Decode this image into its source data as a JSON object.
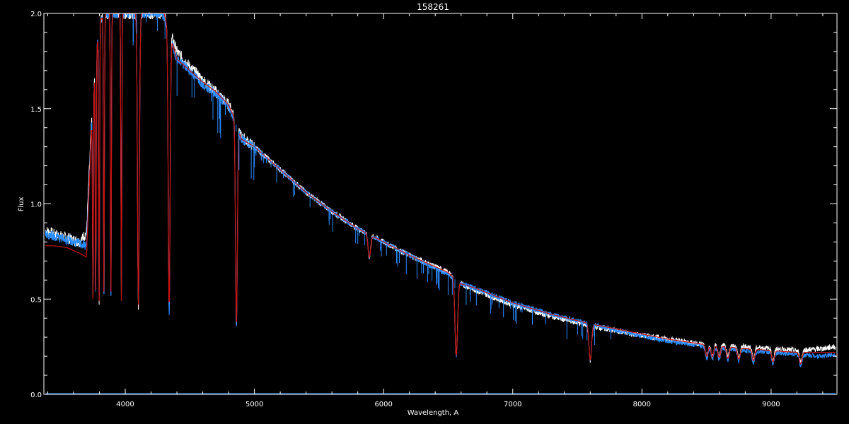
{
  "chart_data": {
    "type": "line",
    "title": "158261",
    "xlabel": "Wavelength, A",
    "ylabel": "Flux",
    "xlim": [
      3370,
      9510
    ],
    "ylim": [
      0.0,
      2.0
    ],
    "xticks": [
      4000,
      5000,
      6000,
      7000,
      8000,
      9000
    ],
    "yticks": [
      0.0,
      0.5,
      1.0,
      1.5,
      2.0
    ],
    "ytick_labels": [
      "0.0",
      "0.5",
      "1.0",
      "1.5",
      "2.0"
    ],
    "grid": false,
    "colors": {
      "background": "#000000",
      "axes": "#ffffff",
      "observed": "#ffffff",
      "model": "#cc1111",
      "fit": "#2a8cff"
    },
    "series": [
      {
        "key": "observed",
        "x": [
          3380,
          3450,
          3550,
          3650,
          3700,
          3750,
          3800,
          3850,
          3900,
          3950,
          4000,
          4050,
          4150,
          4200,
          4250,
          4300,
          4400,
          4500,
          4600,
          4700,
          4800,
          4840,
          4900,
          5000,
          5200,
          5400,
          5600,
          5800,
          6000,
          6200,
          6400,
          6500,
          6600,
          6700,
          7000,
          7300,
          7600,
          7900,
          8200,
          8500,
          8800,
          9000,
          9200,
          9400,
          9490
        ],
        "y": [
          0.86,
          0.84,
          0.82,
          0.8,
          0.85,
          1.6,
          1.96,
          2.0,
          2.0,
          2.0,
          2.0,
          2.0,
          2.0,
          2.0,
          2.0,
          2.0,
          1.8,
          1.72,
          1.65,
          1.59,
          1.52,
          1.47,
          1.35,
          1.3,
          1.18,
          1.06,
          0.96,
          0.87,
          0.8,
          0.73,
          0.67,
          0.64,
          0.58,
          0.55,
          0.47,
          0.41,
          0.36,
          0.32,
          0.29,
          0.26,
          0.25,
          0.24,
          0.23,
          0.24,
          0.25
        ]
      },
      {
        "key": "model",
        "x": [
          3380,
          3450,
          3550,
          3650,
          3700,
          3750,
          3800,
          3850,
          3900,
          3950,
          4000,
          4050,
          4150,
          4200,
          4250,
          4300,
          4400,
          4500,
          4600,
          4700,
          4800,
          4840,
          4900,
          5000,
          5200,
          5400,
          5600,
          5800,
          6000,
          6200,
          6400,
          6500,
          6600,
          6700,
          7000,
          7300,
          7600,
          7900,
          8200,
          8500,
          8800,
          9000,
          9200,
          9400,
          9490
        ],
        "y": [
          0.78,
          0.78,
          0.77,
          0.74,
          0.72,
          1.6,
          1.96,
          2.0,
          2.0,
          2.0,
          2.0,
          2.0,
          2.0,
          2.0,
          2.0,
          2.0,
          1.76,
          1.7,
          1.64,
          1.59,
          1.52,
          1.46,
          1.34,
          1.3,
          1.18,
          1.06,
          0.96,
          0.87,
          0.8,
          0.73,
          0.67,
          0.64,
          0.58,
          0.56,
          0.48,
          0.42,
          0.37,
          0.33,
          0.29,
          0.26,
          0.24,
          0.23,
          0.22,
          0.22,
          0.22
        ]
      },
      {
        "key": "fit",
        "x": [
          3380,
          3450,
          3550,
          3650,
          3700,
          3750,
          3800,
          3850,
          3900,
          3950,
          4000,
          4050,
          4150,
          4200,
          4250,
          4300,
          4400,
          4500,
          4600,
          4700,
          4800,
          4840,
          4900,
          5000,
          5200,
          5400,
          5600,
          5800,
          6000,
          6200,
          6400,
          6500,
          6600,
          6700,
          7000,
          7300,
          7600,
          7900,
          8200,
          8500,
          8800,
          9000,
          9200,
          9400,
          9490
        ],
        "y": [
          0.84,
          0.83,
          0.81,
          0.79,
          0.78,
          1.6,
          1.96,
          2.0,
          2.0,
          2.0,
          2.0,
          2.0,
          2.0,
          2.0,
          2.0,
          1.98,
          1.76,
          1.7,
          1.63,
          1.58,
          1.51,
          1.45,
          1.34,
          1.3,
          1.18,
          1.06,
          0.96,
          0.87,
          0.8,
          0.73,
          0.66,
          0.63,
          0.58,
          0.56,
          0.48,
          0.42,
          0.37,
          0.32,
          0.28,
          0.25,
          0.23,
          0.22,
          0.21,
          0.2,
          0.21
        ]
      }
    ],
    "absorption_lines": [
      {
        "x": 3750,
        "depth": 0.5
      },
      {
        "x": 3771,
        "depth": 0.5
      },
      {
        "x": 3798,
        "depth": 0.49
      },
      {
        "x": 3835,
        "depth": 0.48
      },
      {
        "x": 3889,
        "depth": 0.48
      },
      {
        "x": 3970,
        "depth": 0.49
      },
      {
        "x": 4102,
        "depth": 0.47
      },
      {
        "x": 4340,
        "depth": 0.43
      },
      {
        "x": 4861,
        "depth": 0.37
      },
      {
        "x": 5890,
        "depth": 0.72
      },
      {
        "x": 6563,
        "depth": 0.2
      },
      {
        "x": 7600,
        "depth": 0.18
      }
    ],
    "paschen_lines": [
      8502,
      8545,
      8598,
      8665,
      8750,
      8863,
      9015,
      9229
    ],
    "bottom_trace_y": 0.0
  }
}
